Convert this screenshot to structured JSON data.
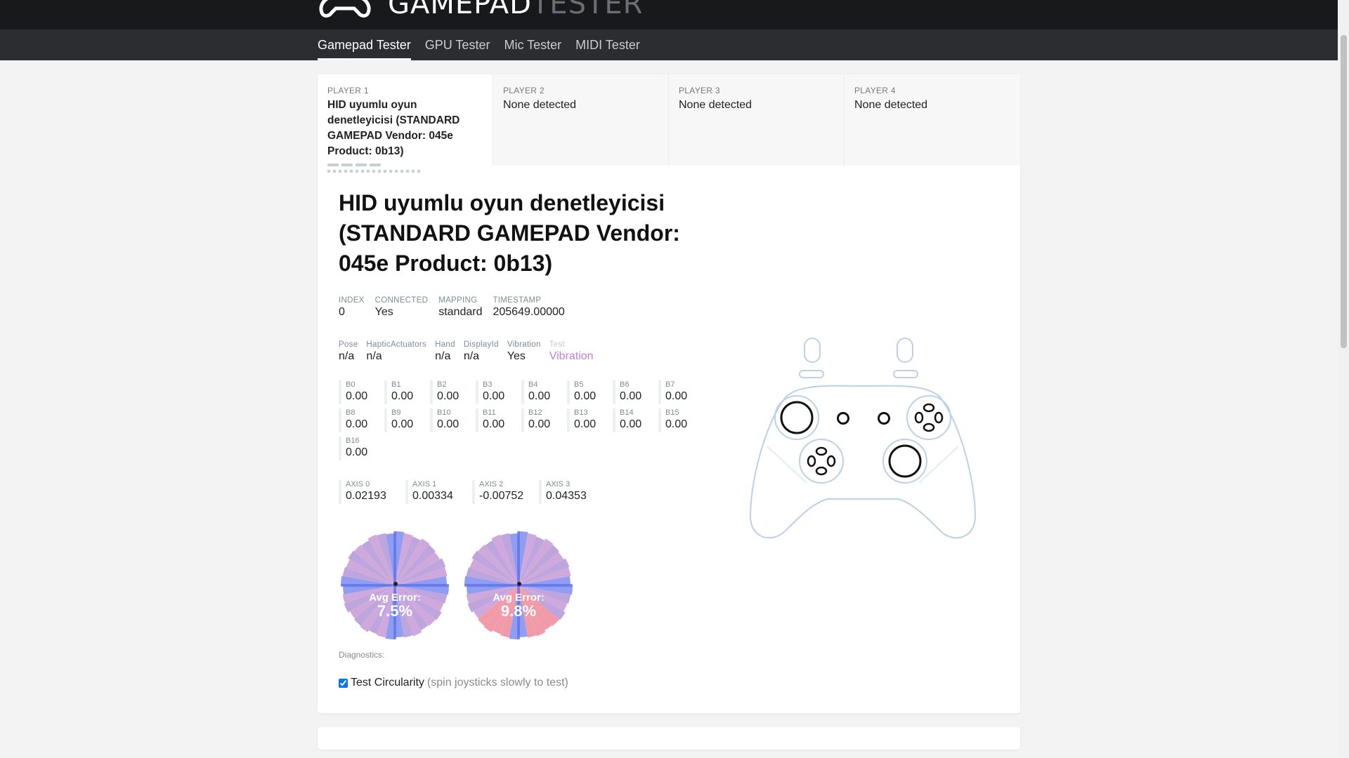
{
  "brand": {
    "word_main": "GAMEPAD",
    "word_dim": "TESTER"
  },
  "nav": {
    "items": [
      "Gamepad Tester",
      "GPU Tester",
      "Mic Tester",
      "MIDI Tester"
    ]
  },
  "players": [
    {
      "label": "PLAYER 1",
      "name": "HID uyumlu oyun denetleyicisi (STANDARD GAMEPAD Vendor: 045e Product: 0b13)"
    },
    {
      "label": "PLAYER 2",
      "name": "None detected"
    },
    {
      "label": "PLAYER 3",
      "name": "None detected"
    },
    {
      "label": "PLAYER 4",
      "name": "None detected"
    }
  ],
  "gamepad": {
    "title": "HID uyumlu oyun denetleyicisi (STANDARD GAMEPAD Vendor: 045e Product: 0b13)",
    "info": [
      {
        "k": "INDEX",
        "v": "0"
      },
      {
        "k": "CONNECTED",
        "v": "Yes"
      },
      {
        "k": "MAPPING",
        "v": "standard"
      },
      {
        "k": "TIMESTAMP",
        "v": "205649.00000"
      }
    ],
    "props": [
      {
        "k": "Pose",
        "v": "n/a"
      },
      {
        "k": "HapticActuators",
        "v": "n/a"
      },
      {
        "k": "Hand",
        "v": "n/a"
      },
      {
        "k": "DisplayId",
        "v": "n/a"
      },
      {
        "k": "Vibration",
        "v": "Yes"
      },
      {
        "k": "Test",
        "v": "Vibration"
      }
    ],
    "buttons": [
      {
        "label": "B0",
        "value": "0.00"
      },
      {
        "label": "B1",
        "value": "0.00"
      },
      {
        "label": "B2",
        "value": "0.00"
      },
      {
        "label": "B3",
        "value": "0.00"
      },
      {
        "label": "B4",
        "value": "0.00"
      },
      {
        "label": "B5",
        "value": "0.00"
      },
      {
        "label": "B6",
        "value": "0.00"
      },
      {
        "label": "B7",
        "value": "0.00"
      },
      {
        "label": "B8",
        "value": "0.00"
      },
      {
        "label": "B9",
        "value": "0.00"
      },
      {
        "label": "B10",
        "value": "0.00"
      },
      {
        "label": "B11",
        "value": "0.00"
      },
      {
        "label": "B12",
        "value": "0.00"
      },
      {
        "label": "B13",
        "value": "0.00"
      },
      {
        "label": "B14",
        "value": "0.00"
      },
      {
        "label": "B15",
        "value": "0.00"
      },
      {
        "label": "B16",
        "value": "0.00"
      }
    ],
    "axes": [
      {
        "label": "AXIS 0",
        "value": "0.02193"
      },
      {
        "label": "AXIS 1",
        "value": "0.00334"
      },
      {
        "label": "AXIS 2",
        "value": "-0.00752"
      },
      {
        "label": "AXIS 3",
        "value": "0.04353"
      }
    ],
    "circularity": [
      {
        "caption": "Avg Error:",
        "value": "7.5%"
      },
      {
        "caption": "Avg Error:",
        "value": "9.8%"
      }
    ],
    "diagnostics_label": "Diagnostics:",
    "test_circularity": {
      "label": "Test Circularity",
      "hint": "(spin joysticks slowly to test)",
      "checked": true
    }
  },
  "colors": {
    "topbar": "#17191b",
    "navbar": "#2b2d30",
    "accent_link": "#c07ed1",
    "controller_stroke": "#bcd0e6"
  }
}
